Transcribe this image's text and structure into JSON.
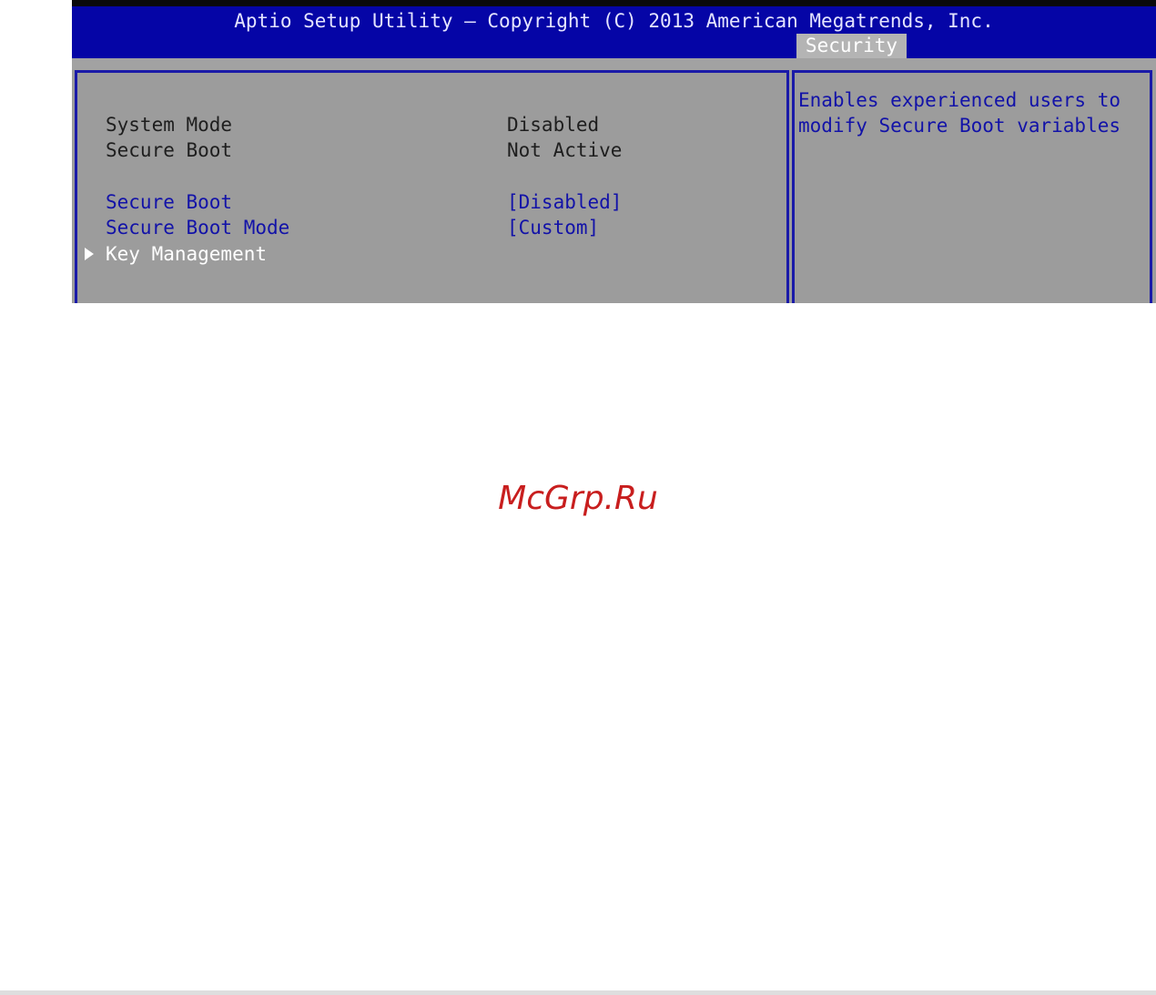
{
  "header": {
    "title": "Aptio Setup Utility – Copyright (C) 2013 American Megatrends, Inc.",
    "active_tab": "Security"
  },
  "info_items": [
    {
      "label": "System Mode",
      "value": "Disabled"
    },
    {
      "label": "Secure Boot",
      "value": "Not Active"
    }
  ],
  "settings": [
    {
      "label": "Secure Boot",
      "value": "[Disabled]"
    },
    {
      "label": "Secure Boot Mode",
      "value": "[Custom]"
    }
  ],
  "submenu": {
    "label": "Key Management",
    "icon": "triangle-right-icon"
  },
  "help_text": "Enables experienced users to\nmodify Secure Boot variables",
  "watermark": "McGrp.Ru",
  "colors": {
    "header_bg": "#0505a6",
    "panel_bg": "#9c9c9c",
    "setting_text": "#1212a8",
    "border": "#1a1aa8",
    "watermark": "#c81e1e"
  }
}
